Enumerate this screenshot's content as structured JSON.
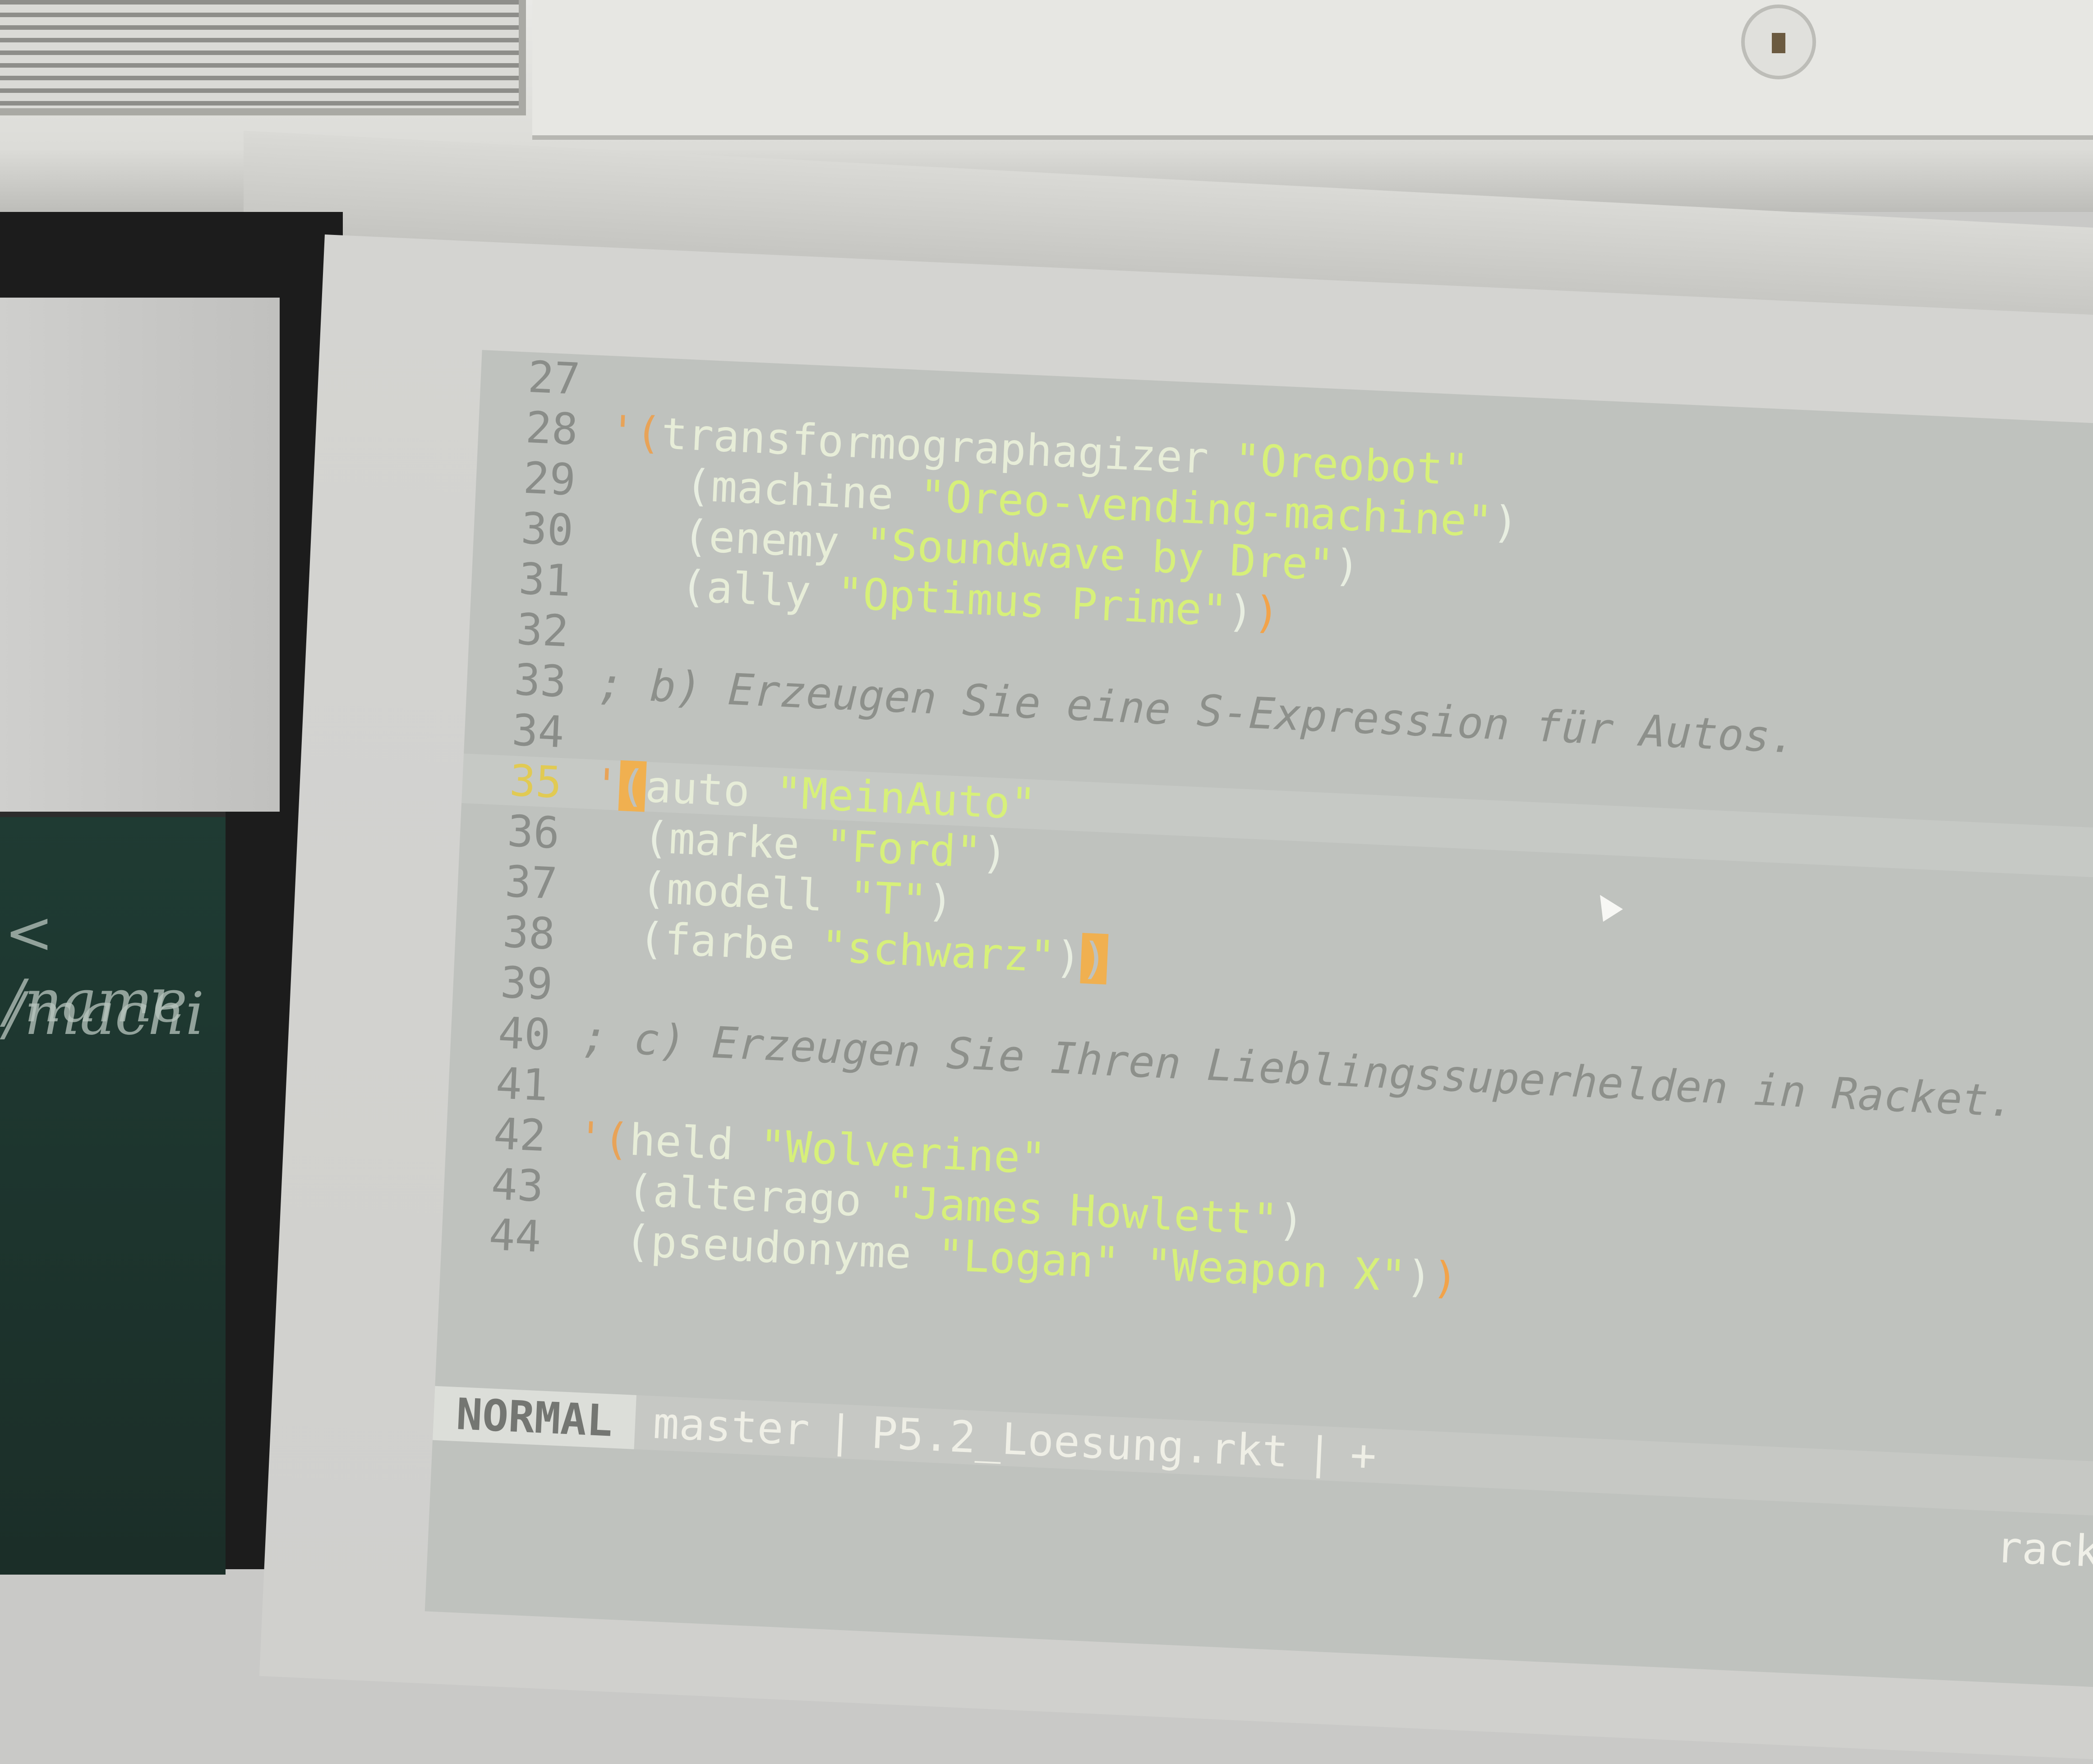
{
  "editor": {
    "lines": [
      {
        "num": "27"
      },
      {
        "num": "28",
        "open": "'(",
        "head": "transformographagizer",
        "args": [
          "\"Oreobot\""
        ]
      },
      {
        "num": "29",
        "indent": "   ",
        "open": "(",
        "head": "machine",
        "args": [
          "\"Oreo-vending-machine\""
        ],
        "close": ")"
      },
      {
        "num": "30",
        "indent": "   ",
        "open": "(",
        "head": "enemy",
        "args": [
          "\"Soundwave by Dre\""
        ],
        "close": ")"
      },
      {
        "num": "31",
        "indent": "   ",
        "open": "(",
        "head": "ally",
        "args": [
          "\"Optimus Prime\""
        ],
        "close": ")",
        "close2": ")"
      },
      {
        "num": "32"
      },
      {
        "num": "33",
        "comment": "; b) Erzeugen Sie eine S-Expression für Autos."
      },
      {
        "num": "34"
      },
      {
        "num": "35",
        "open": "'(",
        "head": "auto",
        "args": [
          "\"MeinAuto\""
        ],
        "current": true
      },
      {
        "num": "36",
        "indent": "  ",
        "open": "(",
        "head": "marke",
        "args": [
          "\"Ford\""
        ],
        "close": ")"
      },
      {
        "num": "37",
        "indent": "  ",
        "open": "(",
        "head": "modell",
        "args": [
          "\"T\""
        ],
        "close": ")"
      },
      {
        "num": "38",
        "indent": "  ",
        "open": "(",
        "head": "farbe",
        "args": [
          "\"schwarz\""
        ],
        "close": ")",
        "close2": ")"
      },
      {
        "num": "39"
      },
      {
        "num": "40",
        "comment": "; c) Erzeugen Sie Ihren Lieblingssuperhelden in Racket."
      },
      {
        "num": "41"
      },
      {
        "num": "42",
        "open": "'(",
        "head": "held",
        "args": [
          "\"Wolverine\""
        ]
      },
      {
        "num": "43",
        "indent": "  ",
        "open": "(",
        "head": "alterago",
        "args": [
          "\"James Howlett\""
        ],
        "close": ")"
      },
      {
        "num": "44",
        "indent": "  ",
        "open": "(",
        "head": "pseudonyme",
        "args": [
          "\"Logan\"",
          "\"Weapon X\""
        ],
        "close": ")",
        "close2": ")"
      }
    ]
  },
  "statusbar": {
    "mode": "NORMAL",
    "branch": "master",
    "separator": "|",
    "filename": "P5.2_Loesung.rkt",
    "modified": "+",
    "filetype": "racket"
  },
  "colors": {
    "string": "#d7f07a",
    "symbol": "#e7edd8",
    "paren": "#e8eee1",
    "quote": "#e8a358",
    "comment": "#8d908b",
    "current_line_number": "#e1ca53",
    "cursor": "#f0b050"
  },
  "icons": {
    "mouse_pointer": "arrow-cursor-icon"
  }
}
